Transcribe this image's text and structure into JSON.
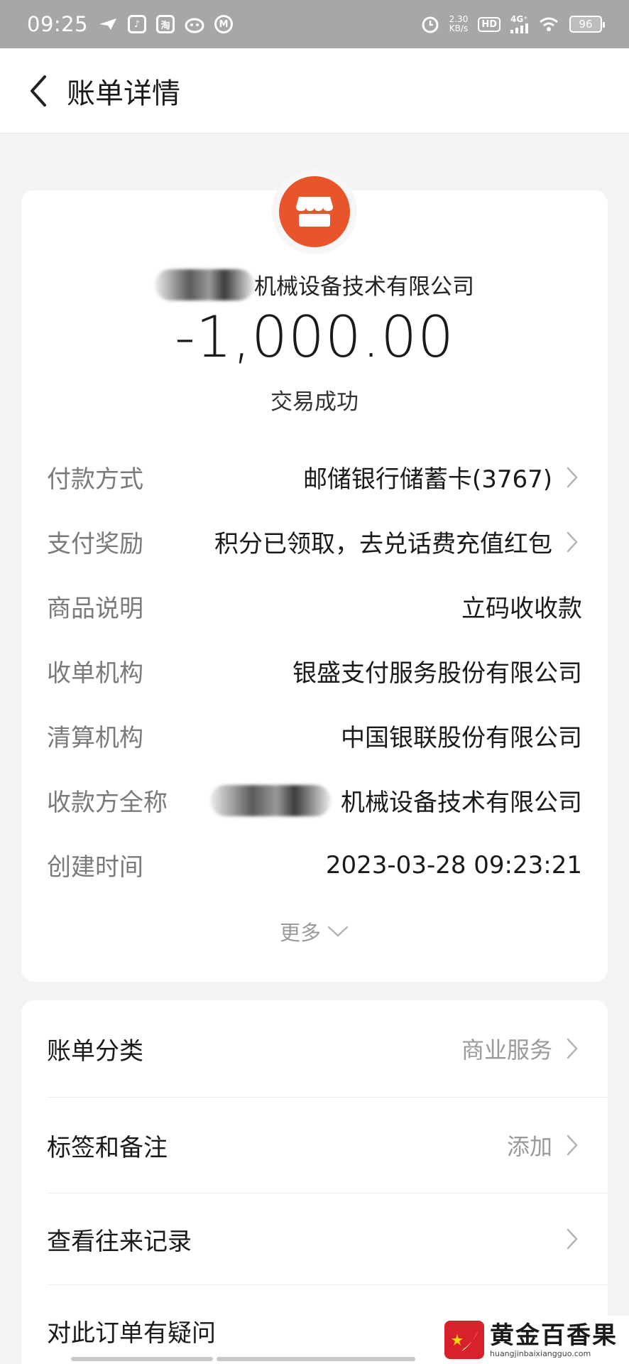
{
  "status_bar": {
    "time": "09:25",
    "app_icons": [
      "plane-icon",
      "tiktok-icon",
      "taobao-icon",
      "cat-icon",
      "m-icon"
    ],
    "taobao_glyph": "淘",
    "net_speed_value": "2.30",
    "net_speed_unit": "KB/s",
    "hd": "HD",
    "network": "4G⁺",
    "battery": "96"
  },
  "header": {
    "title": "账单详情"
  },
  "summary": {
    "merchant_name_visible": "机械设备技术有限公司",
    "amount": "-1,000.00",
    "status": "交易成功",
    "logo_color": "#e8552b"
  },
  "details": [
    {
      "label": "付款方式",
      "value": "邮储银行储蓄卡(3767)",
      "chevron": true
    },
    {
      "label": "支付奖励",
      "value": "积分已领取，去兑话费充值红包",
      "chevron": true
    },
    {
      "label": "商品说明",
      "value": "立码收收款",
      "chevron": false
    },
    {
      "label": "收单机构",
      "value": "银盛支付服务股份有限公司",
      "chevron": false
    },
    {
      "label": "清算机构",
      "value": "中国银联股份有限公司",
      "chevron": false
    },
    {
      "label": "收款方全称",
      "value": "机械设备技术有限公司",
      "chevron": false
    },
    {
      "label": "创建时间",
      "value": "2023-03-28 09:23:21",
      "chevron": false
    }
  ],
  "more_label": "更多",
  "actions": [
    {
      "label": "账单分类",
      "value": "商业服务"
    },
    {
      "label": "标签和备注",
      "value": "添加"
    },
    {
      "label": "查看往来记录",
      "value": ""
    },
    {
      "label": "对此订单有疑问",
      "value": ""
    }
  ],
  "watermark": {
    "title": "黄金百香果",
    "url": "huangjinbaixiangguo.com",
    "color": "#d7222b"
  }
}
